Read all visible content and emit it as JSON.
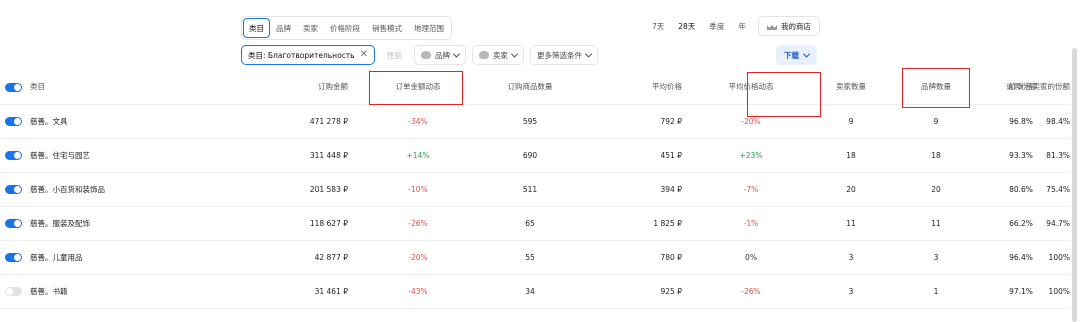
{
  "category_tabs": [
    "类目",
    "品牌",
    "卖家",
    "价格阶段",
    "销售模式",
    "地理范围"
  ],
  "period_tabs": [
    "7天",
    "28天",
    "季度",
    "年"
  ],
  "my_store": "我的商店",
  "filters": {
    "category_chip": "类目: Благотворительность",
    "gender": "性别",
    "brand": "品牌",
    "seller": "卖家",
    "more": "更多筛选条件",
    "download": "下载"
  },
  "table": {
    "headers": [
      "类目",
      "订购金额",
      "订单金额动态",
      "订购商品数量",
      "平均价格",
      "平均价格动态",
      "卖家数量",
      "品牌数量",
      "认购份额",
      "前 5 名卖家的份额"
    ],
    "rows": [
      {
        "toggle_on": true,
        "category": "慈善。文具",
        "amount": "471 278 ₽",
        "amount_dyn": "-34%",
        "qty": "595",
        "avg_price": "792 ₽",
        "price_dyn": "-20%",
        "sellers": "9",
        "brands": "9",
        "share": "96.8%",
        "top5": "98.4%"
      },
      {
        "toggle_on": true,
        "category": "慈善。住宅与园艺",
        "amount": "311 448 ₽",
        "amount_dyn": "+14%",
        "qty": "690",
        "avg_price": "451 ₽",
        "price_dyn": "+23%",
        "sellers": "18",
        "brands": "18",
        "share": "93.3%",
        "top5": "81.3%"
      },
      {
        "toggle_on": true,
        "category": "慈善。小百货和装饰品",
        "amount": "201 583 ₽",
        "amount_dyn": "-10%",
        "qty": "511",
        "avg_price": "394 ₽",
        "price_dyn": "-7%",
        "sellers": "20",
        "brands": "20",
        "share": "80.6%",
        "top5": "75.4%"
      },
      {
        "toggle_on": true,
        "category": "慈善。服装及配饰",
        "amount": "118 627 ₽",
        "amount_dyn": "-26%",
        "qty": "65",
        "avg_price": "1 825 ₽",
        "price_dyn": "-1%",
        "sellers": "11",
        "brands": "11",
        "share": "66.2%",
        "top5": "94.7%"
      },
      {
        "toggle_on": true,
        "category": "慈善。儿童用品",
        "amount": "42 877 ₽",
        "amount_dyn": "-20%",
        "qty": "55",
        "avg_price": "780 ₽",
        "price_dyn": "0%",
        "sellers": "3",
        "brands": "3",
        "share": "96.4%",
        "top5": "100%"
      },
      {
        "toggle_on": false,
        "category": "慈善。书籍",
        "amount": "31 461 ₽",
        "amount_dyn": "-43%",
        "qty": "34",
        "avg_price": "925 ₽",
        "price_dyn": "-26%",
        "sellers": "3",
        "brands": "1",
        "share": "97.1%",
        "top5": "100%"
      }
    ]
  },
  "colors": {
    "accent": "#1a73e8",
    "negative": "#d9534f",
    "positive": "#2e9e46",
    "highlight_box": "#e02424"
  }
}
